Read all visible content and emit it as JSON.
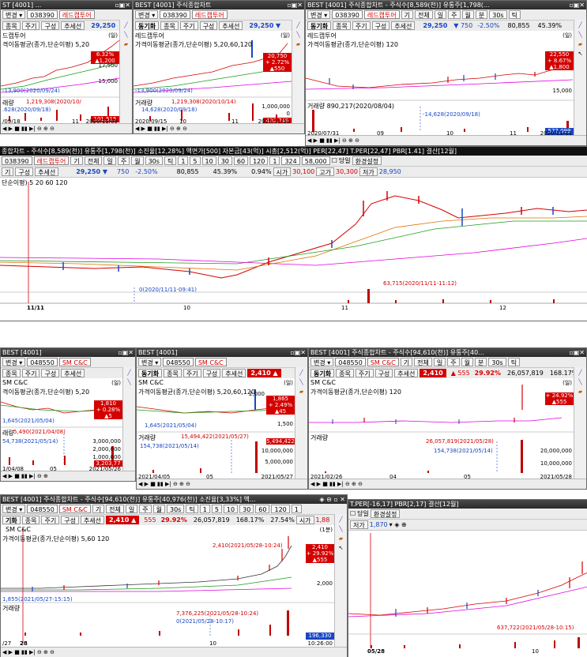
{
  "top": {
    "w1": {
      "title": "ST [4001] ...",
      "code": "038390",
      "name": "레드캡투어",
      "tabs": [
        "종목",
        "주기",
        "구성",
        "추세선"
      ],
      "price": "29,250",
      "stock_label": "드캡투어",
      "ma_label": "격이동평균(종가,단순이평) 5,20",
      "vol_label": "래량",
      "ann_peak": "1,219,308(2020/10/",
      "ann_low": "-13,900(2020/09/24)",
      "ann_vol": ".628(2020/09/18)",
      "axis_y": [
        "17,500",
        "15,000"
      ],
      "rbox": [
        "6.32%",
        "▲1,200"
      ],
      "vbox": "101,515",
      "x_labels": [
        "/09/18",
        "11",
        "2020/11/09"
      ],
      "unit": "(일)"
    },
    "w2": {
      "title": "BEST [4001] 주식종합차트",
      "code": "038390",
      "name": "레드캡투어",
      "tabs": [
        "동기화",
        "종목",
        "주기",
        "구성",
        "추세선"
      ],
      "price": "29,250 ▼",
      "stock_label": "레드캡투어",
      "ma_label": "가격이동평균(종가,단순이평) 5,20,60,120",
      "vol_label": "거래량",
      "ann_peak": "1,219,308(2020/10/14)",
      "ann_low": "-13,900(2020/09/24)",
      "ann_vol": "14,628(2020/09/18)",
      "axis_y": [
        "20,750",
        "+ 2.72%",
        "▲550",
        "1,000,000",
        "0",
        "430,749"
      ],
      "x_labels": [
        "2020/09/15",
        "10",
        "11",
        "2020/11/10"
      ],
      "unit": "(일)"
    },
    "w3": {
      "title": "BEST [4001] 주식종합차트 - 주식수[8,589(천)] 유통주[1,798(...",
      "code": "038390",
      "name": "레드캡투어",
      "tabs": [
        "동기화",
        "종목",
        "주기",
        "구성",
        "추세선"
      ],
      "period": [
        "기",
        "전체",
        "일",
        "주",
        "월",
        "분",
        "30s",
        "틱"
      ],
      "price": "29,250",
      "change": "▼ 750",
      "pct": "-2.50%",
      "vol": "80,855",
      "ratio": "45.39%",
      "stock_label": "레드캡투어",
      "ma_label": "가격이동평균(종가,단순이평) 120",
      "vol_label": "거래량 890,217(2020/08/04)",
      "ann_vol": "-14,628(2020/09/18)",
      "axis_y": [
        "22,550",
        "+ 8.67%",
        "▲1,800",
        "15,000",
        "577,099"
      ],
      "x_labels": [
        "2020/07/31",
        "09",
        "10",
        "11",
        "2020/11/11"
      ],
      "unit": "(일)"
    }
  },
  "mid": {
    "title": "종합차트 - 주식수[8,589(천)] 유통주[1,798(천)] 소진율[12,28%] 액면가[500] 자본금[43(억)] 시총[2,512(억)] PER[22,47] T.PER[22,47] PBR[1.41] 결산[12월]",
    "code": "038390",
    "name": "레드캡투어",
    "period": [
      "기",
      "전체",
      "일",
      "주",
      "월",
      "30s",
      "틱",
      "1",
      "5",
      "10",
      "30",
      "60",
      "120",
      "1"
    ],
    "extra": [
      "324",
      "58,000"
    ],
    "toggle": "당일",
    "env": "환경설정",
    "tabs": [
      "기",
      "구성",
      "추세선"
    ],
    "price": "29,250 ▼",
    "change": "750",
    "pct": "-2.50%",
    "vol": "80,855",
    "ratio": "45.39%",
    "ratio2": "0.94%",
    "open_label": "시가",
    "open": "30,100",
    "high_label": "고가",
    "high": "30,300",
    "low_label": "저가",
    "low": "28,950",
    "ma_label": "단순이평) 5 20 60 120",
    "ann_vol": "63,715(2020/11/11-11:12)",
    "ann_zero": "0(2020/11/11-09:41)",
    "x_labels": [
      "11/11",
      "10",
      "11",
      "12"
    ]
  },
  "bottom": {
    "w4": {
      "title": "BEST [4001]",
      "code": "048550",
      "name": "SM C&C",
      "tabs": [
        "종목",
        "주기",
        "구성",
        "추세선"
      ],
      "stock_label": "SM C&C",
      "ma_label": "격이동평균(종가,단순이평) 5,20",
      "vol_label": "래량",
      "ann_vol": "5,490(2021/04/08)",
      "ann_vol2": "54,738(2021/05/14)",
      "ann_low": "1,645(2021/05/04)",
      "axis_y": [
        "1,810",
        "+ 0.28%",
        "▲5",
        "3,000,000",
        "2,000,000",
        "1,000,000",
        "3,203,77"
      ],
      "x_labels": [
        "1/04/08",
        "05",
        "2021/05/26"
      ],
      "unit": "(일)"
    },
    "w5": {
      "title": "BEST [4001]",
      "code": "048550",
      "name": "SM C&C",
      "tabs": [
        "동기화",
        "종목",
        "주기",
        "구성",
        "추세선"
      ],
      "price": "2,410 ▲",
      "stock_label": "SM C&C",
      "ma_label": "가격이동평균(종가,단순이평) 5,20,60,120",
      "vol_label": "거래량",
      "ann_peak": "15,494,422(2021/05/27)",
      "ann_vol": "154,738(2021/05/14)",
      "ann_low": "1,645(2021/05/04)",
      "axis_y": [
        "2,000",
        "1,865",
        "+ 2.49%",
        "▲45",
        "1,500",
        "10,000,000",
        "5,000,000",
        "5,494,422"
      ],
      "x_labels": [
        "2021/04/05",
        "05",
        "2021/05/27"
      ],
      "unit": "(일)"
    },
    "w6": {
      "title": "BEST [4001] 주식종합차트 - 주식수[94,610(천)] 유통주[40...",
      "code": "048550",
      "name": "SM C&C",
      "tabs": [
        "동기화",
        "종목",
        "주기",
        "구성",
        "추세선"
      ],
      "period": [
        "기",
        "전체",
        "일",
        "주",
        "월",
        "분",
        "30s",
        "틱"
      ],
      "price": "2,410",
      "change": "▲ 555",
      "pct": "29.92%",
      "vol": "26,057,819",
      "ratio": "168.17%",
      "stock_label": "SM C&C",
      "ma_label": "가격이동평균(종가,단순이평) 120",
      "vol_label": "거래량",
      "ann_peak": "26,057,819(2021/05/28)",
      "ann_vol": "154,738(2021/05/14)",
      "axis_y": [
        "+ 24.92%",
        "▲555",
        "20,000,000",
        "10,000,000"
      ],
      "x_labels": [
        "2021/02/26",
        "04",
        "05",
        "2021/05/28"
      ],
      "unit": "(일)"
    }
  },
  "lower": {
    "w7": {
      "title": "BEST [4001] 주식종합차트 - 주식수[94,610(천)] 유통주[40,976(천)] 소진율[3,33%] 액...",
      "code": "048550",
      "name": "SM C&C",
      "tabs": [
        "기화",
        "종목",
        "주기",
        "구성",
        "추세선"
      ],
      "period": [
        "기",
        "전체",
        "일",
        "주",
        "월",
        "30s",
        "틱",
        "1",
        "5",
        "10",
        "30",
        "60",
        "120",
        "1"
      ],
      "price": "2,410 ▲",
      "change": "555",
      "pct": "29.92%",
      "vol": "26,057,819",
      "ratio": "168.17%",
      "ratio2": "27.54%",
      "open_label": "시가",
      "open": "1,88",
      "stock_label": "SM C&C",
      "ma_label": "가격이동평균(종가,단순이평) 5,60 120",
      "vol_label": "거래량",
      "ann_peak": "2,410(2021/05/28-10:24)",
      "ann_low": "1,855(2021/05/27-15:15)",
      "ann_vol": "7,376,225(2021/05/28-10:24)",
      "ann_zero": "0(2021/05/28-10:17)",
      "axis_y": [
        "2,410",
        "+ 29.92%",
        "▲555",
        "2,000",
        "196,330"
      ],
      "x_labels": [
        "/27",
        "28",
        "10",
        "10:26:00"
      ],
      "unit": "(1분)"
    },
    "w8": {
      "title": "T.PER[-16,17] PBR[2,17] 결산[12월]",
      "toggle": "당일",
      "env": "환경설정",
      "period": [
        "기",
        "전체",
        "일",
        "주",
        "월",
        "30s",
        "틱",
        "1",
        "5",
        "10",
        "30",
        "60",
        "120",
        "1"
      ],
      "low_label": "저가",
      "low": "1,870",
      "ann_vol": "637,722(2021/05/28-10:15)",
      "x_labels": [
        "05/28",
        "10"
      ]
    }
  },
  "colors": {
    "up": "#d40000",
    "down": "#1846c4",
    "ma5": "#d40000",
    "ma20": "#e07000",
    "ma60": "#1a9c1a",
    "ma120": "#e000e0",
    "vol": "#c00000"
  }
}
